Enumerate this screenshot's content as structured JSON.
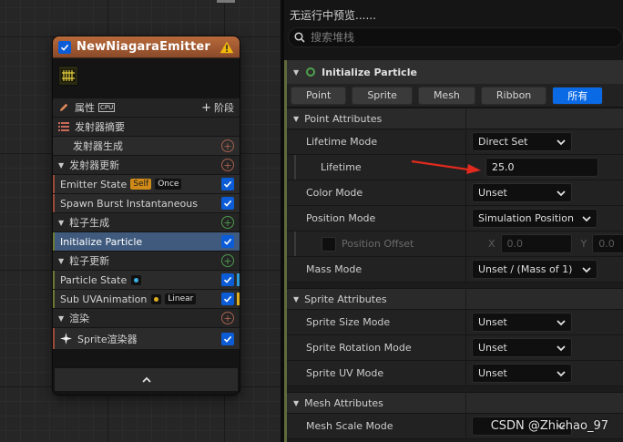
{
  "node": {
    "title": "NewNiagaraEmitter",
    "properties_label": "属性",
    "cpu_label": "CPU",
    "stage_button": "阶段",
    "summary_label": "发射器摘要",
    "rows": {
      "emitter_spawn": "发射器生成",
      "emitter_update": "发射器更新",
      "emitter_state": "Emitter State",
      "emitter_state_badge_self": "Self",
      "emitter_state_badge_once": "Once",
      "spawn_burst": "Spawn Burst Instantaneous",
      "particle_spawn": "粒子生成",
      "initialize_particle": "Initialize Particle",
      "particle_update": "粒子更新",
      "particle_state": "Particle State",
      "sub_uv": "Sub UVAnimation",
      "sub_uv_badge": "Linear",
      "render": "渲染",
      "sprite_renderer": "Sprite渲染器"
    }
  },
  "panel": {
    "status": "无运行中预览......",
    "search_placeholder": "搜索堆栈",
    "module_title": "Initialize Particle",
    "tabs": [
      "Point",
      "Sprite",
      "Mesh",
      "Ribbon",
      "所有"
    ],
    "active_tab": "所有",
    "point_attributes": {
      "header": "Point Attributes",
      "lifetime_mode_label": "Lifetime Mode",
      "lifetime_mode_value": "Direct Set",
      "lifetime_label": "Lifetime",
      "lifetime_value": "25.0",
      "color_mode_label": "Color Mode",
      "color_mode_value": "Unset",
      "position_mode_label": "Position Mode",
      "position_mode_value": "Simulation Position",
      "position_offset_label": "Position Offset",
      "x_label": "X",
      "x_value": "0.0",
      "y_label": "Y",
      "y_value": "0.0",
      "mass_mode_label": "Mass Mode",
      "mass_mode_value": "Unset / (Mass of 1)"
    },
    "sprite_attributes": {
      "header": "Sprite Attributes",
      "size_mode_label": "Sprite Size Mode",
      "size_mode_value": "Unset",
      "rotation_mode_label": "Sprite Rotation Mode",
      "rotation_mode_value": "Unset",
      "uv_mode_label": "Sprite UV Mode",
      "uv_mode_value": "Unset"
    },
    "mesh_attributes": {
      "header": "Mesh Attributes",
      "scale_mode_label": "Mesh Scale Mode"
    }
  },
  "watermark": "CSDN @Zhichao_97",
  "colors": {
    "accent_blue": "#0a6ae6",
    "header_orange": "#b86a3a",
    "selected_row": "#3f5a7d",
    "arrow_red": "#e02a1e"
  }
}
